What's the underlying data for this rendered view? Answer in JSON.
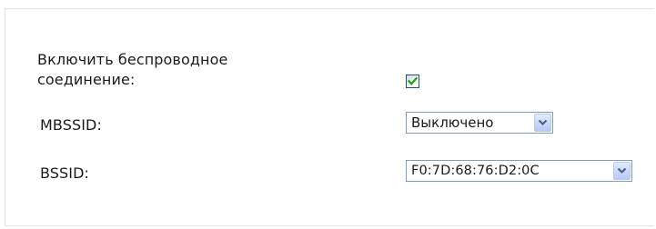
{
  "wireless": {
    "enable_label_line1": "Включить беспроводное",
    "enable_label_line2": "соединение:",
    "enabled": true
  },
  "mbssid": {
    "label": "MBSSID:",
    "selected": "Выключено"
  },
  "bssid": {
    "label": "BSSID:",
    "selected": "F0:7D:68:76:D2:0C"
  },
  "colors": {
    "checkmark": "#21a121",
    "select_border": "#7f9db9",
    "arrow": "#4d6185"
  }
}
